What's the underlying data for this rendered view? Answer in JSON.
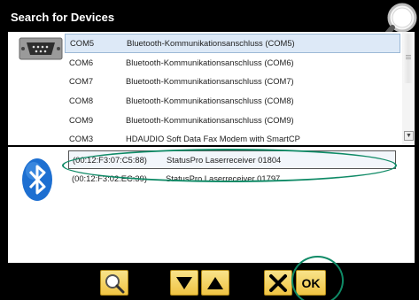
{
  "window": {
    "title": "Search for Devices"
  },
  "com_ports": [
    {
      "port": "COM5",
      "description": "Bluetooth-Kommunikationsanschluss (COM5)",
      "selected": true
    },
    {
      "port": "COM6",
      "description": "Bluetooth-Kommunikationsanschluss (COM6)",
      "selected": false
    },
    {
      "port": "COM7",
      "description": "Bluetooth-Kommunikationsanschluss (COM7)",
      "selected": false
    },
    {
      "port": "COM8",
      "description": "Bluetooth-Kommunikationsanschluss (COM8)",
      "selected": false
    },
    {
      "port": "COM9",
      "description": "Bluetooth-Kommunikationsanschluss (COM9)",
      "selected": false
    },
    {
      "port": "COM3",
      "description": "HDAUDIO Soft Data Fax Modem with SmartCP",
      "selected": false
    }
  ],
  "bluetooth_devices": [
    {
      "address": "(00:12:F3:07:C5:88)",
      "name": "StatusPro Laserreceiver 01804",
      "selected": true
    },
    {
      "address": "(00:12:F3:02:EC:39)",
      "name": "StatusPro Laserreceiver 01797",
      "selected": false
    }
  ],
  "toolbar": {
    "search_icon": "search-icon",
    "down_icon": "arrow-down-icon",
    "up_icon": "arrow-up-icon",
    "cancel_icon": "close-icon",
    "ok_label": "OK"
  },
  "colors": {
    "accent_yellow": "#f0c443",
    "highlight_green": "#0f8a66",
    "selection_blue": "#dde9f7",
    "bluetooth_blue": "#1d6fd1"
  }
}
